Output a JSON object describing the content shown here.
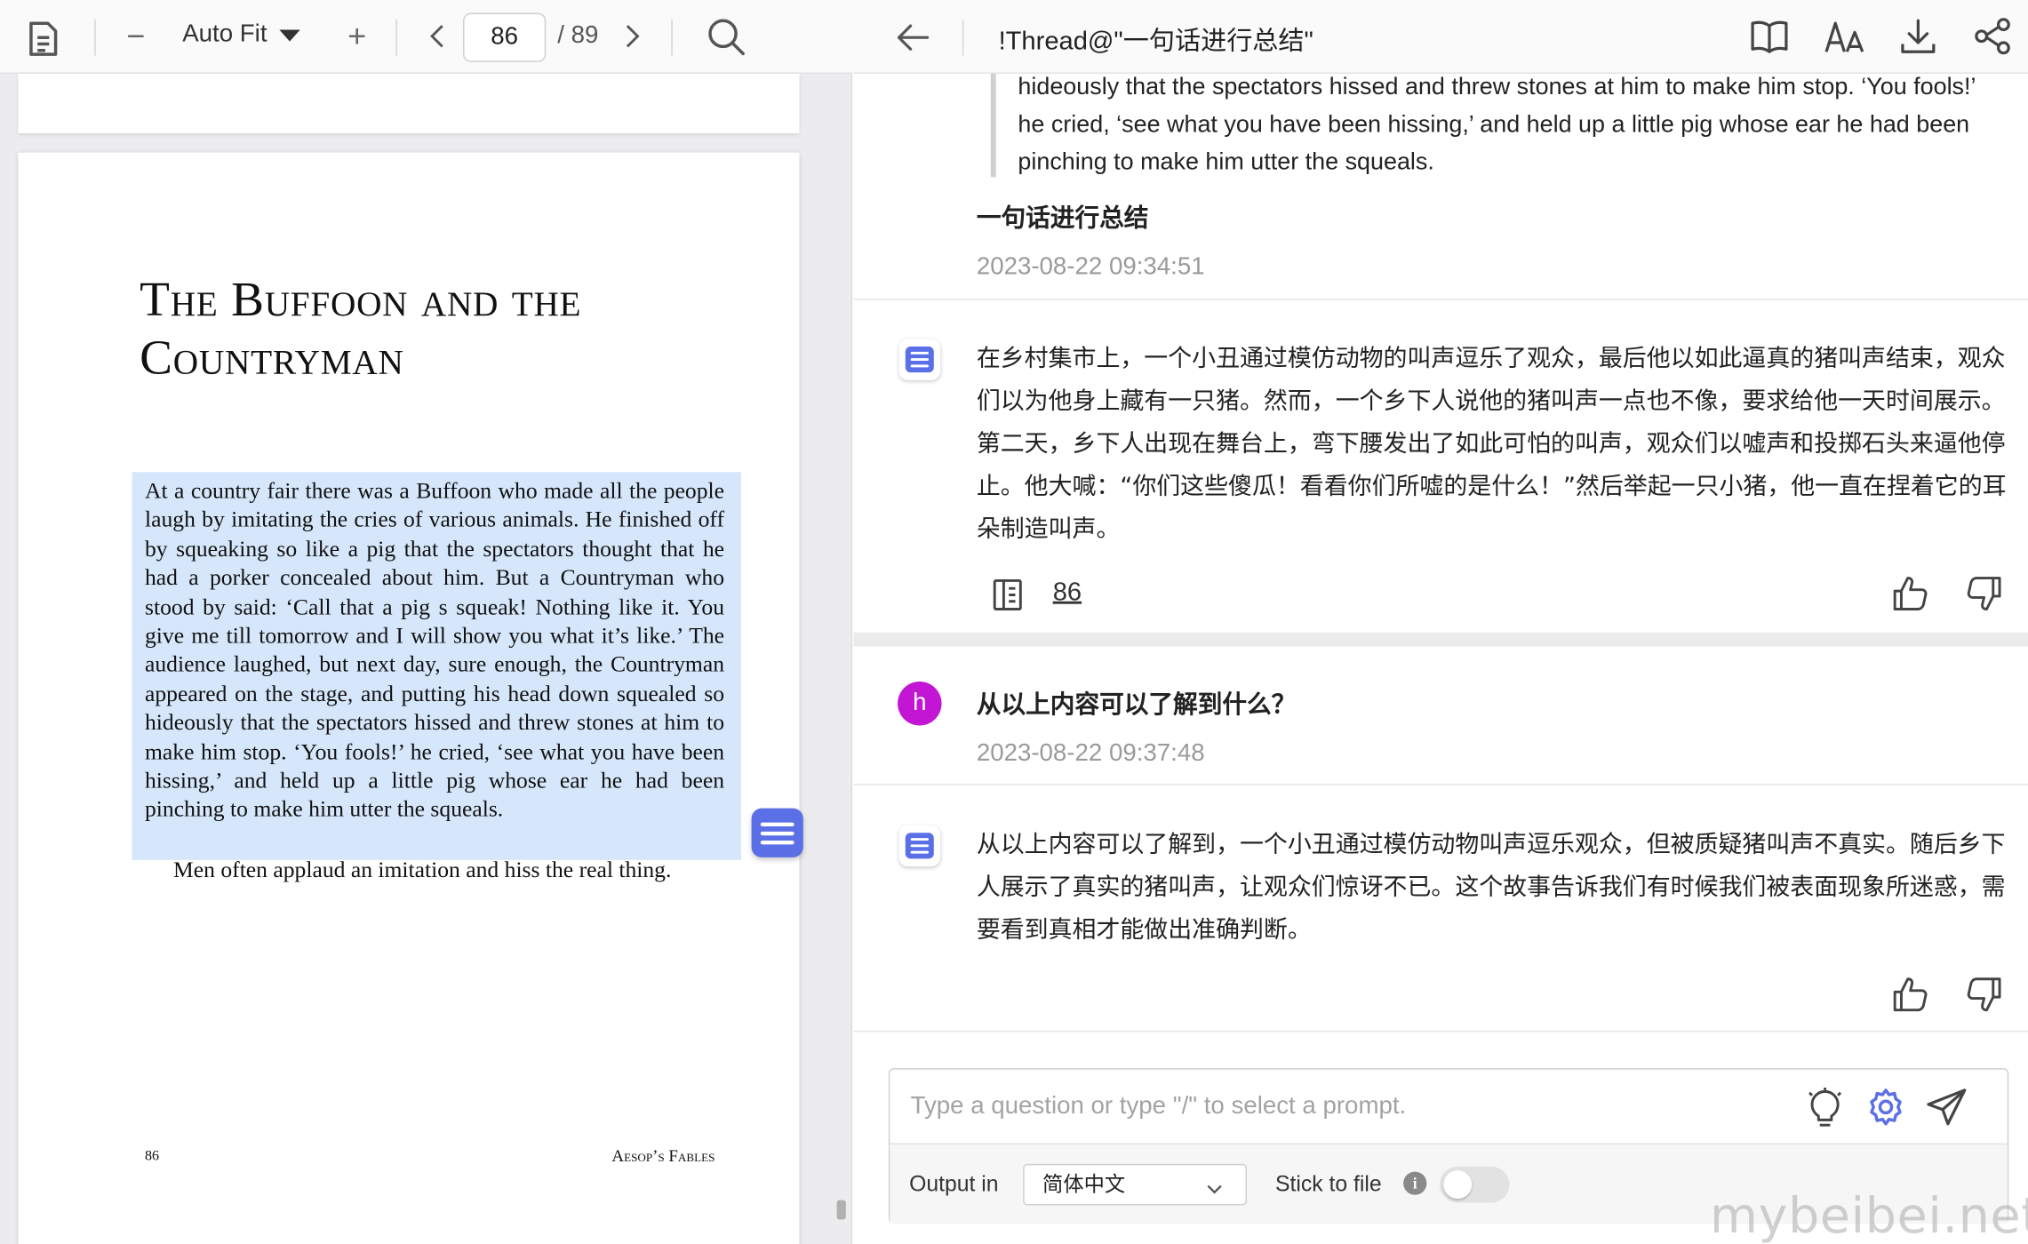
{
  "pdf": {
    "zoom_label": "Auto Fit",
    "current_page": "86",
    "total_pages": "/ 89",
    "page": {
      "title_line1": "The Buffoon and the",
      "title_line2": "Countryman",
      "body": "At a country fair there was a Buffoon who made all the people laugh by imitating the cries of various animals. He finished off by squeaking so like a pig that the spectators thought that he had a porker concealed about him. But a Countryman who stood by said: ‘Call that a pig s squeak! Nothing like it. You give me till tomorrow and I will show you what it’s like.’ The audience laughed, but next day, sure enough, the Countryman appeared on the stage, and putting his head down squealed so hideously that the spectators hissed and threw stones at him to make him stop. ‘You fools!’ he cried, ‘see what you have been hissing,’ and held up a little pig whose ear he had been pinching to make him utter the squeals.",
      "moral": "Men often applaud an imitation and hiss the real thing.",
      "page_number": "86",
      "footer": "Aesop’s Fables"
    }
  },
  "chat": {
    "title": "!Thread@\"一句话进行总结\"",
    "quote_text": "hideously that the spectators hissed and threw stones at him to make him stop. ‘You fools!’ he cried, ‘see what you have been hissing,’ and held up a little pig whose ear he had been pinching to make him utter the squeals.",
    "question1": "一句话进行总结",
    "timestamp1": "2023-08-22 09:34:51",
    "answer1": "在乡村集市上，一个小丑通过模仿动物的叫声逗乐了观众，最后他以如此逼真的猪叫声结束，观众们以为他身上藏有一只猪。然而，一个乡下人说他的猪叫声一点也不像，要求给他一天时间展示。第二天，乡下人出现在舞台上，弯下腰发出了如此可怕的叫声，观众们以嘘声和投掷石头来逼他停止。他大喊：“你们这些傻瓜！看看你们所嘘的是什么！”然后举起一只小猪，他一直在捏着它的耳朵制造叫声。",
    "source_page": "86",
    "user_avatar": "h",
    "question2": "从以上内容可以了解到什么？",
    "timestamp2": "2023-08-22 09:37:48",
    "answer2": "从以上内容可以了解到，一个小丑通过模仿动物叫声逗乐观众，但被质疑猪叫声不真实。随后乡下人展示了真实的猪叫声，让观众们惊讶不已。这个故事告诉我们有时候我们被表面现象所迷惑，需要看到真相才能做出准确判断。",
    "input_placeholder": "Type a question or type \"/\" to select a prompt.",
    "output_label": "Output in",
    "output_language": "简体中文",
    "stick_label": "Stick to file",
    "info_glyph": "i",
    "stick_enabled": false
  },
  "watermark": "mybeibei.net",
  "colors": {
    "accent": "#5b6fe6",
    "avatar": "#c216d4",
    "highlight": "#d6e7fb",
    "muted_text": "#9a9a9a"
  },
  "icons": [
    "document-icon",
    "zoom-out-icon",
    "zoom-in-icon",
    "prev-page-icon",
    "next-page-icon",
    "search-icon",
    "back-arrow-icon",
    "book-icon",
    "font-size-icon",
    "download-icon",
    "mindmap-icon",
    "source-page-icon",
    "thumbs-up-icon",
    "thumbs-down-icon",
    "lightbulb-icon",
    "settings-gear-icon",
    "send-icon",
    "chat-bubble-icon",
    "info-icon",
    "chevron-down-icon"
  ]
}
